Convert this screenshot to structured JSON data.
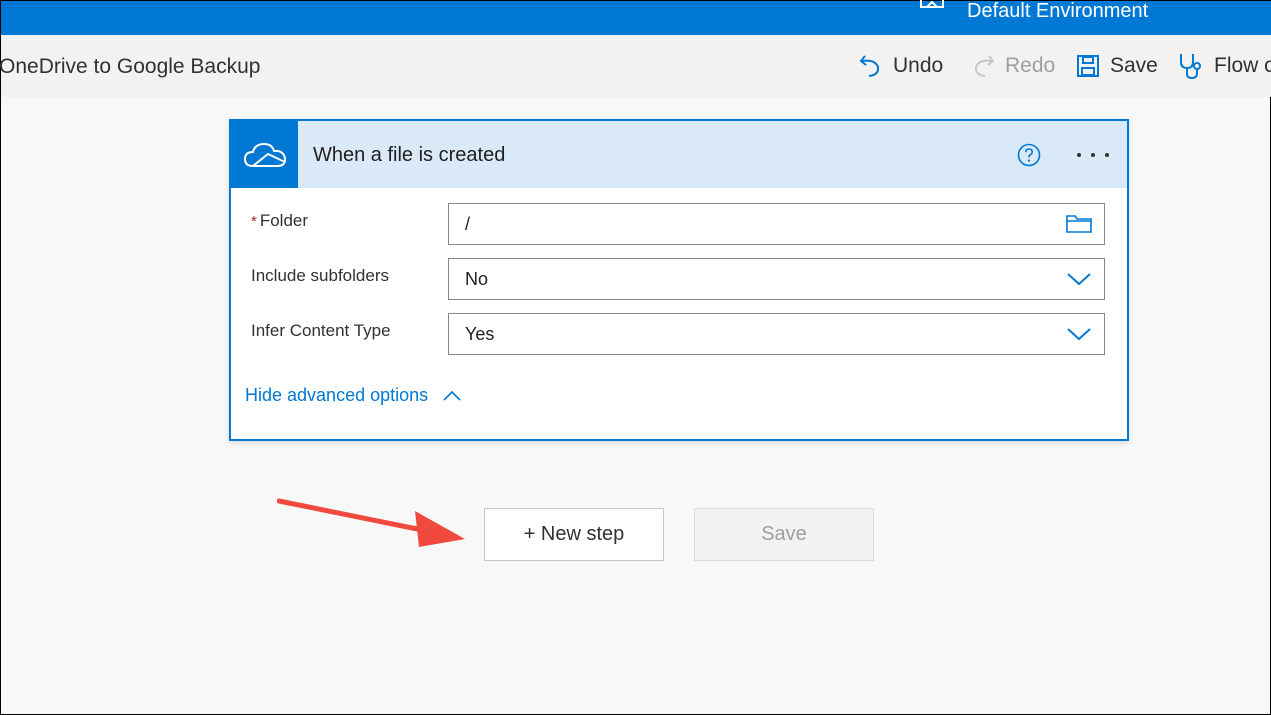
{
  "header": {
    "environment_label": "Default Environment",
    "brand_color": "#0078d4"
  },
  "command_bar": {
    "flow_name": "OneDrive to Google Backup",
    "undo_label": "Undo",
    "redo_label": "Redo",
    "save_label": "Save",
    "checker_label": "Flow c"
  },
  "trigger_card": {
    "title": "When a file is created",
    "icon": "onedrive-cloud-icon",
    "fields": [
      {
        "label": "Folder",
        "required": "*",
        "value": "/",
        "icon": "folder-icon"
      },
      {
        "label": "Include subfolders",
        "value": "No",
        "icon": "chevron-down-icon"
      },
      {
        "label": "Infer Content Type",
        "value": "Yes",
        "icon": "chevron-down-icon"
      }
    ],
    "advanced_link": "Hide advanced options"
  },
  "actions": {
    "new_step_label": "+ New step",
    "save_label": "Save"
  },
  "annotation": {
    "arrow_color": "#f04a3e",
    "arrow_points_to": "new-step-button"
  }
}
